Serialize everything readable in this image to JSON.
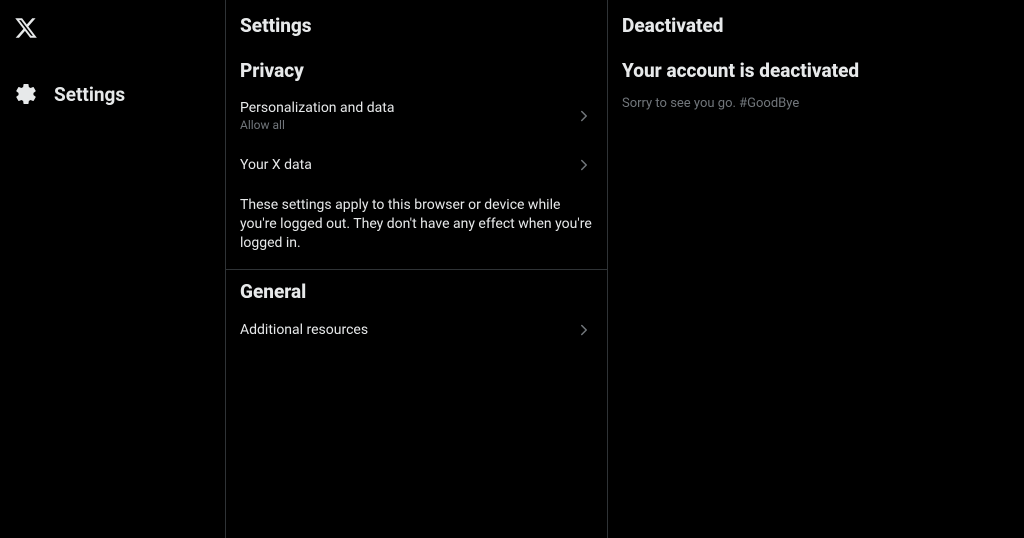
{
  "sidebar": {
    "nav": {
      "settings_label": "Settings"
    }
  },
  "middle": {
    "header": "Settings",
    "privacy": {
      "title": "Privacy",
      "items": [
        {
          "title": "Personalization and data",
          "subtitle": "Allow all"
        },
        {
          "title": "Your X data"
        }
      ],
      "description": "These settings apply to this browser or device while you're logged out. They don't have any effect when you're logged in."
    },
    "general": {
      "title": "General",
      "items": [
        {
          "title": "Additional resources"
        }
      ]
    }
  },
  "right": {
    "header": "Deactivated",
    "subheading": "Your account is deactivated",
    "body": "Sorry to see you go. #GoodBye"
  }
}
